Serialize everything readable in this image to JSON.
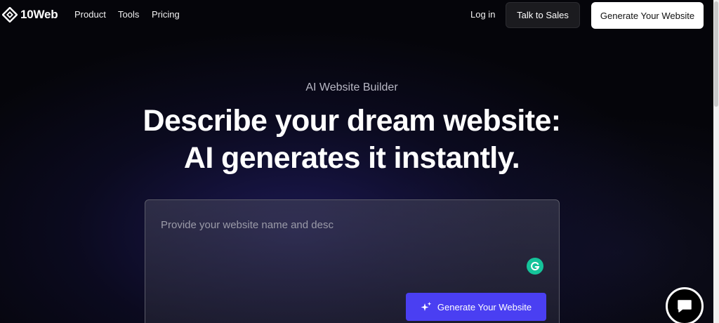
{
  "header": {
    "brand": "10Web",
    "nav": [
      "Product",
      "Tools",
      "Pricing"
    ],
    "login_label": "Log in",
    "talk_to_sales_label": "Talk to Sales",
    "generate_label": "Generate Your Website"
  },
  "hero": {
    "eyebrow": "AI Website Builder",
    "headline_line1": "Describe your dream website:",
    "headline_line2": "AI generates it instantly."
  },
  "prompt": {
    "placeholder": "Provide your website name and desc",
    "value": "",
    "generate_label": "Generate Your Website"
  },
  "colors": {
    "accent": "#4a3ff2",
    "grammarly": "#15c39a",
    "background": "#05050a"
  },
  "icons": {
    "logo": "10web-logo-icon",
    "sparkle": "sparkle-icon",
    "grammarly": "grammarly-icon",
    "chat": "chat-icon"
  }
}
